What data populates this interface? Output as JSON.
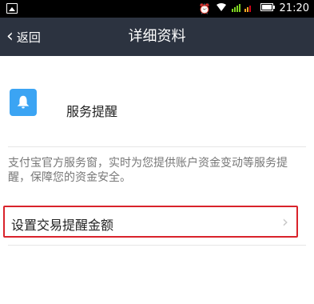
{
  "status_bar": {
    "time": "21:20",
    "icons": [
      "image-icon",
      "alarm-icon",
      "wifi-icon",
      "signal-icon",
      "battery-icon"
    ]
  },
  "nav": {
    "back_label": "返回",
    "title": "详细资料"
  },
  "service": {
    "name": "服务提醒",
    "icon": "bell-icon",
    "icon_color": "#3ba4f3"
  },
  "description": "支付宝官方服务窗，实时为您提供账户资金变动等服务提醒，保障您的资金安全。",
  "setting_item": {
    "label": "设置交易提醒金额",
    "highlight_color": "#d9232b"
  },
  "colors": {
    "navbar_bg": "#2c3340",
    "status_bg": "#000000"
  }
}
